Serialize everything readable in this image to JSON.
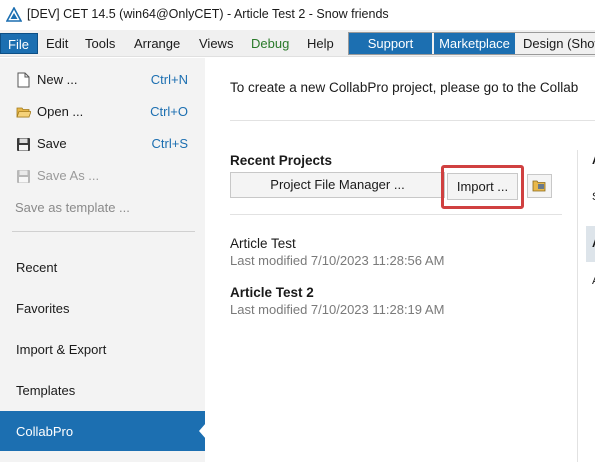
{
  "window": {
    "title": "[DEV] CET 14.5 (win64@OnlyCET) - Article Test 2 - Snow friends"
  },
  "menu": {
    "items": [
      "File",
      "Edit",
      "Tools",
      "Arrange",
      "Views",
      "Debug",
      "Help"
    ],
    "support": "Support",
    "marketplace": "Marketplace",
    "design": "Design (Show"
  },
  "backstage": {
    "commands": [
      {
        "label": "New ...",
        "shortcut": "Ctrl+N",
        "icon": "new-file-icon"
      },
      {
        "label": "Open ...",
        "shortcut": "Ctrl+O",
        "icon": "open-folder-icon"
      },
      {
        "label": "Save",
        "shortcut": "Ctrl+S",
        "icon": "save-icon"
      },
      {
        "label": "Save As ...",
        "shortcut": "",
        "icon": "save-as-icon"
      }
    ],
    "save_template": "Save as template ...",
    "nav": [
      "Recent",
      "Favorites",
      "Import & Export",
      "Templates",
      "CollabPro"
    ]
  },
  "main": {
    "intro": "To create a new CollabPro project, please go to the Collab",
    "recent_title": "Recent Projects",
    "pfm_button": "Project File Manager ...",
    "import_button": "Import ...",
    "projects": [
      {
        "name": "Article Test",
        "modified": "Last modified 7/10/2023 11:28:56 AM"
      },
      {
        "name": "Article Test 2",
        "modified": "Last modified 7/10/2023 11:28:19 AM"
      }
    ]
  },
  "right_column": {
    "line1": "A",
    "line2": "S",
    "line3": "A",
    "line4": "A"
  }
}
